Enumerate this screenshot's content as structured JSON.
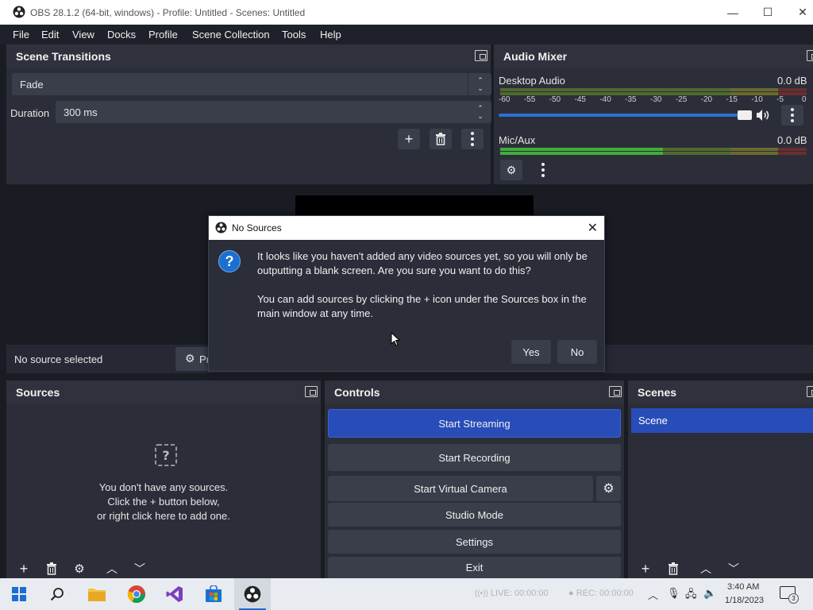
{
  "window": {
    "title": "OBS 28.1.2 (64-bit, windows) - Profile: Untitled - Scenes: Untitled",
    "minimize": "—",
    "maximize": "☐",
    "close": "✕"
  },
  "menu": [
    "File",
    "Edit",
    "View",
    "Docks",
    "Profile",
    "Scene Collection",
    "Tools",
    "Help"
  ],
  "scene_transitions": {
    "title": "Scene Transitions",
    "transition": "Fade",
    "duration_label": "Duration",
    "duration_value": "300 ms",
    "add": "+"
  },
  "audio_mixer": {
    "title": "Audio Mixer",
    "channels": [
      {
        "name": "Desktop Audio",
        "level": "0.0 dB",
        "volume": 1.0
      },
      {
        "name": "Mic/Aux",
        "level": "0.0 dB"
      }
    ],
    "scale": [
      "-60",
      "-55",
      "-50",
      "-45",
      "-40",
      "-35",
      "-30",
      "-25",
      "-20",
      "-15",
      "-10",
      "-5",
      "0"
    ]
  },
  "preview": {
    "status": "No source selected",
    "properties_label": "Pr"
  },
  "sources": {
    "title": "Sources",
    "empty_line1": "You don't have any sources.",
    "empty_line2": "Click the + button below,",
    "empty_line3": "or right click here to add one.",
    "add": "+"
  },
  "controls": {
    "title": "Controls",
    "start_streaming": "Start Streaming",
    "start_recording": "Start Recording",
    "start_virtual_camera": "Start Virtual Camera",
    "studio_mode": "Studio Mode",
    "settings": "Settings",
    "exit": "Exit"
  },
  "scenes": {
    "title": "Scenes",
    "items": [
      "Scene"
    ],
    "add": "+"
  },
  "dialog": {
    "title": "No Sources",
    "message1": "It looks like you haven't added any video sources yet, so you will only be outputting a blank screen. Are you sure you want to do this?",
    "message2": "You can add sources by clicking the + icon under the Sources box in the main window at any time.",
    "yes": "Yes",
    "no": "No",
    "close": "✕",
    "icon_glyph": "?"
  },
  "taskbar": {
    "live": "LIVE: 00:00:00",
    "rec": "REC: 00:00:00",
    "time": "3:40 AM",
    "date": "1/18/2023",
    "notification_count": "3"
  },
  "colors": {
    "accent": "#284cb8",
    "dialog_icon": "#1a6fd1",
    "meter_green": "#4f8a2a",
    "meter_red": "#8a2a2a"
  }
}
